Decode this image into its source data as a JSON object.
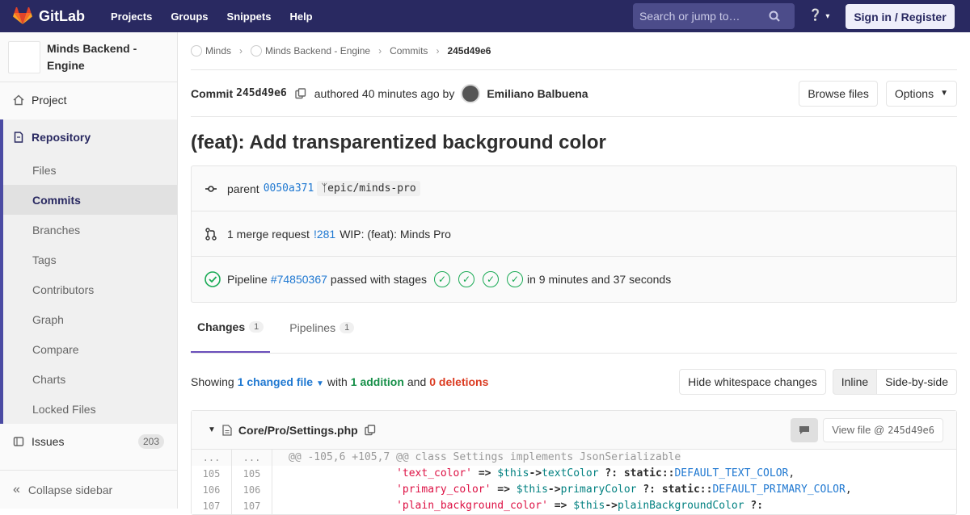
{
  "navbar": {
    "brand": "GitLab",
    "links": [
      "Projects",
      "Groups",
      "Snippets",
      "Help"
    ],
    "search_placeholder": "Search or jump to…",
    "sign_in": "Sign in / Register"
  },
  "sidebar": {
    "project_name": "Minds Backend - Engine",
    "project": "Project",
    "repository": "Repository",
    "repo_items": [
      "Files",
      "Commits",
      "Branches",
      "Tags",
      "Contributors",
      "Graph",
      "Compare",
      "Charts",
      "Locked Files"
    ],
    "active_item": "Commits",
    "issues": "Issues",
    "issues_count": "203",
    "collapse": "Collapse sidebar"
  },
  "breadcrumb": {
    "group": "Minds",
    "project": "Minds Backend - Engine",
    "section": "Commits",
    "current": "245d49e6"
  },
  "commit": {
    "label": "Commit",
    "sha": "245d49e6",
    "authored": "authored 40 minutes ago by",
    "author": "Emiliano Balbuena",
    "browse_files": "Browse files",
    "options": "Options",
    "title": "(feat): Add transparentized background color",
    "parent_label": "parent",
    "parent_sha": "0050a371",
    "branch": "epic/minds-pro",
    "mr_text": "1 merge request",
    "mr_link": "!281",
    "mr_title": "WIP: (feat): Minds Pro",
    "pipeline_label": "Pipeline",
    "pipeline_link": "#74850367",
    "pipeline_status": "passed with stages",
    "pipeline_duration": "in 9 minutes and 37 seconds"
  },
  "tabs": {
    "changes": "Changes",
    "changes_count": "1",
    "pipelines": "Pipelines",
    "pipelines_count": "1"
  },
  "summary": {
    "showing": "Showing",
    "changed": "1 changed file",
    "with": "with",
    "additions": "1 addition",
    "and": "and",
    "deletions": "0 deletions",
    "hide_whitespace": "Hide whitespace changes",
    "inline": "Inline",
    "side_by_side": "Side-by-side"
  },
  "file": {
    "path": "Core/Pro/Settings.php",
    "view_file": "View file @",
    "view_sha": "245d49e6"
  },
  "diff": {
    "hunk_old": "...",
    "hunk_new": "...",
    "hunk": "@@ -105,6 +105,7 @@ class Settings implements JsonSerializable",
    "lines": [
      {
        "old": "105",
        "new": "105",
        "key": "'text_color'",
        "var": "textColor",
        "const": "DEFAULT_TEXT_COLOR"
      },
      {
        "old": "106",
        "new": "106",
        "key": "'primary_color'",
        "var": "primaryColor",
        "const": "DEFAULT_PRIMARY_COLOR"
      },
      {
        "old": "107",
        "new": "107",
        "key": "'plain_background_color'",
        "var": "plainBackgroundColor",
        "const": ""
      }
    ]
  }
}
